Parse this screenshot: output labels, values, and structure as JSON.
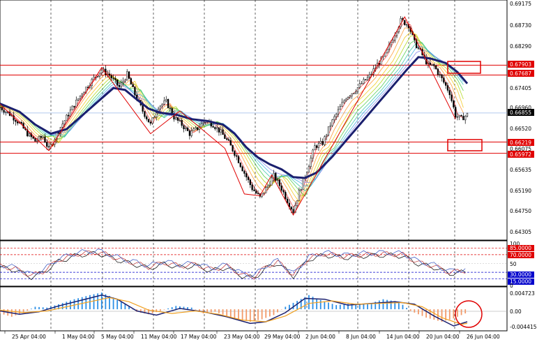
{
  "colors": {
    "background": "#ffffff",
    "candle": "#000000",
    "ma": "#1a1f6e",
    "resistance": "#e00000",
    "grid": "#000000",
    "current_price": "#9ab8e8",
    "rsi_level_high": "#e00000",
    "rsi_level_low": "#0000cc",
    "macd_pos": "#2b8fe6",
    "macd_neg": "#f29a6a",
    "signal": "#f0a020"
  },
  "chart_data": [
    {
      "type": "candlestick",
      "pane": "main",
      "x_labels": [
        "25 Apr 04:00",
        "1 May 04:00",
        "5 May 04:00",
        "11 May 04:00",
        "17 May 04:00",
        "23 May 04:00",
        "29 May 04:00",
        "2 Jun 04:00",
        "8 Jun 04:00",
        "14 Jun 04:00",
        "20 Jun 04:00",
        "26 Jun 04:00"
      ],
      "y_ticks": [
        0.69175,
        0.6873,
        0.6829,
        0.67405,
        0.6696,
        0.6652,
        0.66075,
        0.65635,
        0.6519,
        0.6475,
        0.64305
      ],
      "ylim": [
        0.641,
        0.693
      ],
      "price_path": [
        [
          0,
          0.6698
        ],
        [
          5,
          0.6683
        ],
        [
          10,
          0.6663
        ],
        [
          14,
          0.664
        ],
        [
          18,
          0.6624
        ],
        [
          22,
          0.6634
        ],
        [
          25,
          0.6605
        ],
        [
          30,
          0.6648
        ],
        [
          36,
          0.669
        ],
        [
          42,
          0.673
        ],
        [
          48,
          0.6762
        ],
        [
          52,
          0.678
        ],
        [
          56,
          0.6768
        ],
        [
          61,
          0.6742
        ],
        [
          65,
          0.677
        ],
        [
          69,
          0.6726
        ],
        [
          73,
          0.669
        ],
        [
          77,
          0.666
        ],
        [
          81,
          0.67
        ],
        [
          85,
          0.671
        ],
        [
          89,
          0.6676
        ],
        [
          93,
          0.666
        ],
        [
          97,
          0.664
        ],
        [
          101,
          0.6652
        ],
        [
          105,
          0.667
        ],
        [
          109,
          0.666
        ],
        [
          113,
          0.6643
        ],
        [
          117,
          0.662
        ],
        [
          121,
          0.659
        ],
        [
          125,
          0.6554
        ],
        [
          129,
          0.652
        ],
        [
          133,
          0.65
        ],
        [
          137,
          0.6526
        ],
        [
          140,
          0.6548
        ],
        [
          144,
          0.652
        ],
        [
          147,
          0.6493
        ],
        [
          150,
          0.647
        ],
        [
          153,
          0.6512
        ],
        [
          157,
          0.656
        ],
        [
          161,
          0.6612
        ],
        [
          165,
          0.662
        ],
        [
          169,
          0.666
        ],
        [
          173,
          0.669
        ],
        [
          177,
          0.672
        ],
        [
          181,
          0.6733
        ],
        [
          185,
          0.675
        ],
        [
          189,
          0.6766
        ],
        [
          193,
          0.6792
        ],
        [
          197,
          0.6812
        ],
        [
          201,
          0.685
        ],
        [
          205,
          0.6888
        ],
        [
          209,
          0.6878
        ],
        [
          212,
          0.684
        ],
        [
          215,
          0.682
        ],
        [
          219,
          0.679
        ],
        [
          222,
          0.6788
        ],
        [
          226,
          0.676
        ],
        [
          230,
          0.673
        ],
        [
          233,
          0.668
        ],
        [
          236,
          0.6673
        ],
        [
          239,
          0.6682
        ]
      ],
      "resistance_levels": [
        0.67903,
        0.67687,
        0.66219,
        0.65972
      ],
      "current_price": 0.66855,
      "zigzag": [
        [
          0,
          0.6705
        ],
        [
          25,
          0.6603
        ],
        [
          52,
          0.6785
        ],
        [
          77,
          0.664
        ],
        [
          92,
          0.669
        ],
        [
          115,
          0.6608
        ],
        [
          125,
          0.6508
        ],
        [
          133,
          0.6504
        ],
        [
          139,
          0.655
        ],
        [
          150,
          0.6462
        ],
        [
          163,
          0.656
        ],
        [
          207,
          0.6896
        ],
        [
          233,
          0.6672
        ]
      ],
      "ma": [
        [
          0,
          0.6706
        ],
        [
          10,
          0.6688
        ],
        [
          18,
          0.666
        ],
        [
          26,
          0.664
        ],
        [
          34,
          0.665
        ],
        [
          42,
          0.668
        ],
        [
          50,
          0.671
        ],
        [
          58,
          0.674
        ],
        [
          64,
          0.6736
        ],
        [
          70,
          0.6715
        ],
        [
          76,
          0.6695
        ],
        [
          82,
          0.6686
        ],
        [
          90,
          0.6682
        ],
        [
          98,
          0.6672
        ],
        [
          106,
          0.6668
        ],
        [
          114,
          0.666
        ],
        [
          120,
          0.664
        ],
        [
          126,
          0.661
        ],
        [
          132,
          0.6588
        ],
        [
          138,
          0.6573
        ],
        [
          144,
          0.6562
        ],
        [
          150,
          0.6545
        ],
        [
          156,
          0.6543
        ],
        [
          162,
          0.6555
        ],
        [
          170,
          0.659
        ],
        [
          178,
          0.663
        ],
        [
          186,
          0.667
        ],
        [
          194,
          0.671
        ],
        [
          202,
          0.675
        ],
        [
          208,
          0.678
        ],
        [
          214,
          0.6808
        ],
        [
          220,
          0.6805
        ],
        [
          228,
          0.6795
        ],
        [
          234,
          0.6775
        ],
        [
          239,
          0.675
        ]
      ],
      "labels": {
        "tick_1": "0.69175",
        "tick_2": "0.68730",
        "tick_3": "0.68290",
        "tick_4": "0.67405",
        "tick_5": "0.66960",
        "tick_6": "0.66520",
        "tick_7": "0.66075",
        "tick_8": "0.65635",
        "tick_9": "0.65190",
        "tick_10": "0.64750",
        "tick_11": "0.64305",
        "level_1": "0.67903",
        "level_2": "0.67687",
        "level_3": "0.66219",
        "level_4": "0.65972",
        "current": "0.66855"
      }
    },
    {
      "type": "line",
      "pane": "rsi",
      "y_ticks": [
        100,
        85,
        70,
        50,
        30,
        15,
        0
      ],
      "ylim": [
        0,
        100
      ],
      "levels": {
        "upper": [
          85,
          70
        ],
        "lower": [
          30,
          15
        ]
      },
      "labels": {
        "tick_100": "100",
        "tick_85": "85.0000",
        "tick_70": "70.0000",
        "tick_50": "50",
        "tick_30": "30.0000",
        "tick_15": "15.0000",
        "tick_0": "0"
      },
      "series_path": [
        [
          0,
          44
        ],
        [
          8,
          38
        ],
        [
          16,
          22
        ],
        [
          22,
          32
        ],
        [
          30,
          58
        ],
        [
          40,
          72
        ],
        [
          50,
          76
        ],
        [
          56,
          68
        ],
        [
          62,
          58
        ],
        [
          68,
          52
        ],
        [
          76,
          42
        ],
        [
          84,
          52
        ],
        [
          92,
          44
        ],
        [
          100,
          48
        ],
        [
          108,
          36
        ],
        [
          116,
          44
        ],
        [
          124,
          24
        ],
        [
          130,
          20
        ],
        [
          136,
          42
        ],
        [
          142,
          54
        ],
        [
          150,
          24
        ],
        [
          158,
          62
        ],
        [
          166,
          72
        ],
        [
          176,
          66
        ],
        [
          186,
          70
        ],
        [
          196,
          72
        ],
        [
          206,
          70
        ],
        [
          214,
          52
        ],
        [
          222,
          44
        ],
        [
          230,
          30
        ],
        [
          239,
          34
        ]
      ]
    },
    {
      "type": "bar",
      "pane": "macd",
      "y_ticks": [
        0.004723,
        0.0,
        -0.004415
      ],
      "ylim": [
        -0.005,
        0.0052
      ],
      "labels": {
        "tick_top": "0.004723",
        "tick_zero": "0.00",
        "tick_bottom": "-0.004415"
      },
      "histogram": [
        [
          0,
          -0.001
        ],
        [
          6,
          -0.0018
        ],
        [
          12,
          -0.0008
        ],
        [
          18,
          0.0006
        ],
        [
          24,
          0.0004
        ],
        [
          30,
          0.0012
        ],
        [
          38,
          0.0024
        ],
        [
          46,
          0.0034
        ],
        [
          52,
          0.004
        ],
        [
          58,
          0.0028
        ],
        [
          64,
          0.0012
        ],
        [
          70,
          -0.0006
        ],
        [
          76,
          -0.0012
        ],
        [
          82,
          -0.0004
        ],
        [
          90,
          0.0008
        ],
        [
          98,
          0.0004
        ],
        [
          104,
          -0.001
        ],
        [
          110,
          -0.0006
        ],
        [
          116,
          -0.0016
        ],
        [
          122,
          -0.0024
        ],
        [
          128,
          -0.003
        ],
        [
          134,
          -0.0024
        ],
        [
          140,
          -0.0014
        ],
        [
          146,
          0.0006
        ],
        [
          152,
          0.002
        ],
        [
          158,
          0.0034
        ],
        [
          164,
          0.0022
        ],
        [
          172,
          0.001
        ],
        [
          180,
          0.0014
        ],
        [
          188,
          0.0012
        ],
        [
          196,
          0.0024
        ],
        [
          204,
          0.0018
        ],
        [
          210,
          -0.0004
        ],
        [
          218,
          -0.002
        ],
        [
          226,
          -0.003
        ],
        [
          232,
          -0.0022
        ],
        [
          239,
          -0.0008
        ]
      ],
      "macd_line": [
        [
          0,
          -0.0004
        ],
        [
          10,
          -0.0012
        ],
        [
          20,
          -0.0006
        ],
        [
          30,
          0.0008
        ],
        [
          42,
          0.0022
        ],
        [
          52,
          0.0034
        ],
        [
          60,
          0.0024
        ],
        [
          70,
          -0.0004
        ],
        [
          80,
          -0.0014
        ],
        [
          92,
          0.0002
        ],
        [
          104,
          -0.0006
        ],
        [
          116,
          -0.0018
        ],
        [
          128,
          -0.0034
        ],
        [
          136,
          -0.003
        ],
        [
          146,
          -0.0008
        ],
        [
          156,
          0.0026
        ],
        [
          166,
          0.0024
        ],
        [
          178,
          0.001
        ],
        [
          190,
          0.0014
        ],
        [
          202,
          0.0018
        ],
        [
          212,
          0.0012
        ],
        [
          222,
          -0.0016
        ],
        [
          232,
          -0.004
        ],
        [
          239,
          -0.003
        ]
      ],
      "signal_line": [
        [
          0,
          -0.0002
        ],
        [
          12,
          -0.0008
        ],
        [
          24,
          -0.0004
        ],
        [
          34,
          0.0006
        ],
        [
          46,
          0.0018
        ],
        [
          56,
          0.0028
        ],
        [
          66,
          0.0018
        ],
        [
          76,
          -0.0002
        ],
        [
          88,
          -0.001
        ],
        [
          100,
          -0.0004
        ],
        [
          112,
          -0.0012
        ],
        [
          124,
          -0.0026
        ],
        [
          136,
          -0.003
        ],
        [
          146,
          -0.0016
        ],
        [
          158,
          0.0014
        ],
        [
          170,
          0.002
        ],
        [
          182,
          0.0012
        ],
        [
          194,
          0.0014
        ],
        [
          206,
          0.0016
        ],
        [
          216,
          0.0006
        ],
        [
          226,
          -0.002
        ],
        [
          236,
          -0.0036
        ],
        [
          239,
          -0.0034
        ]
      ]
    }
  ]
}
